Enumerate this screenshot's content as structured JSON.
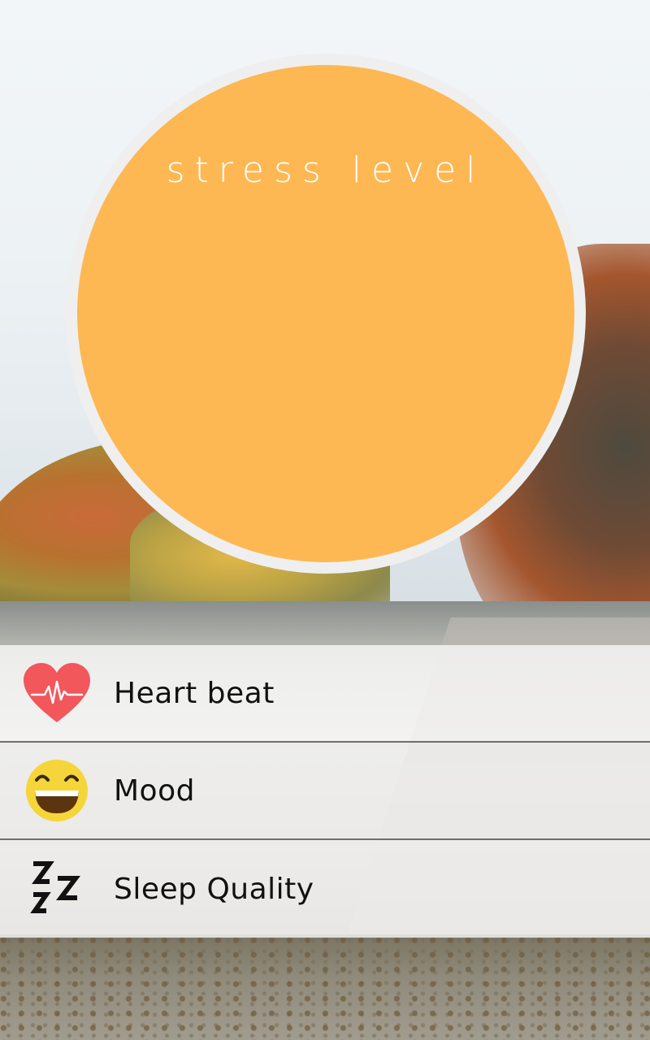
{
  "circle": {
    "title": "stress level",
    "color": "#fdb853"
  },
  "metrics": [
    {
      "label": "Heart beat",
      "icon": "heart-beat-icon",
      "color": "#f2575b"
    },
    {
      "label": "Mood",
      "icon": "grinning-face-icon",
      "color": "#f5d53a"
    },
    {
      "label": "Sleep Quality",
      "icon": "zzz-sleep-icon",
      "color": "#111111"
    }
  ]
}
